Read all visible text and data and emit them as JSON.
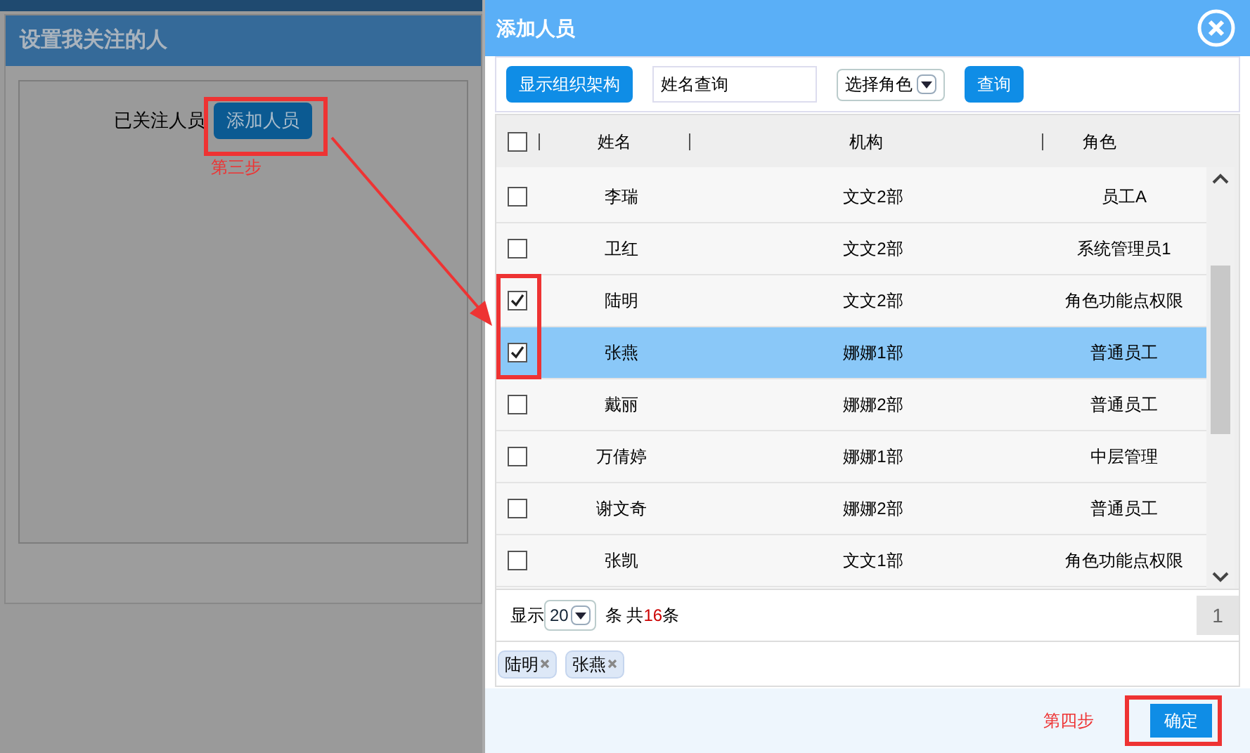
{
  "background_page": {
    "panel_title": "设置我关注的人",
    "followed_label": "已关注人员",
    "add_button": "添加人员"
  },
  "dialog": {
    "title": "添加人员",
    "toolbar": {
      "org_button": "显示组织架构",
      "name_search": {
        "value": "姓名查询"
      },
      "role_select": "选择角色",
      "query_button": "查询"
    },
    "table": {
      "columns": [
        "姓名",
        "机构",
        "角色"
      ],
      "header_checked": false,
      "rows": [
        {
          "name": "李瑞",
          "org": "文文2部",
          "role": "员工A",
          "checked": false,
          "selected": false
        },
        {
          "name": "卫红",
          "org": "文文2部",
          "role": "系统管理员1",
          "checked": false,
          "selected": false
        },
        {
          "name": "陆明",
          "org": "文文2部",
          "role": "角色功能点权限",
          "checked": true,
          "selected": false
        },
        {
          "name": "张燕",
          "org": "娜娜1部",
          "role": "普通员工",
          "checked": true,
          "selected": true
        },
        {
          "name": "戴丽",
          "org": "娜娜2部",
          "role": "普通员工",
          "checked": false,
          "selected": false
        },
        {
          "name": "万倩婷",
          "org": "娜娜1部",
          "role": "中层管理",
          "checked": false,
          "selected": false
        },
        {
          "name": "谢文奇",
          "org": "娜娜2部",
          "role": "普通员工",
          "checked": false,
          "selected": false
        },
        {
          "name": "张凯",
          "org": "文文1部",
          "role": "角色功能点权限",
          "checked": false,
          "selected": false
        }
      ]
    },
    "pagination": {
      "show_label": "显示",
      "page_size": "20",
      "count_prefix": "条 共",
      "total": "16",
      "count_suffix": "条",
      "page": "1"
    },
    "selected_tags": [
      "陆明",
      "张燕"
    ],
    "confirm_button": "确定"
  },
  "annotations": {
    "step3": "第三步",
    "step4": "第四步"
  }
}
